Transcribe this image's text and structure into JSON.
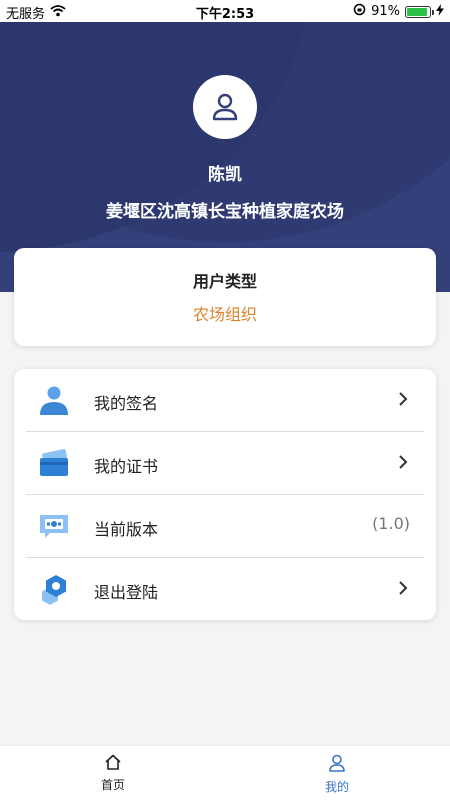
{
  "status_bar": {
    "carrier": "无服务",
    "time": "下午2:53",
    "battery": "91%"
  },
  "profile": {
    "name": "陈凯",
    "organization": "姜堰区沈高镇长宝种植家庭农场"
  },
  "user_type": {
    "title": "用户类型",
    "value": "农场组织"
  },
  "menu": {
    "items": [
      {
        "label": "我的签名",
        "icon": "signature-person-icon"
      },
      {
        "label": "我的证书",
        "icon": "certificate-card-icon"
      },
      {
        "label": "当前版本",
        "icon": "version-chat-icon",
        "value": "(1.0)"
      },
      {
        "label": "退出登陆",
        "icon": "logout-hexagon-icon"
      }
    ]
  },
  "tab_bar": {
    "tabs": [
      {
        "label": "首页",
        "icon": "home-icon"
      },
      {
        "label": "我的",
        "icon": "person-icon"
      }
    ],
    "active": "我的"
  },
  "colors": {
    "header": "#33407a",
    "accent_orange": "#d9852b",
    "tab_active": "#3a73c8"
  }
}
